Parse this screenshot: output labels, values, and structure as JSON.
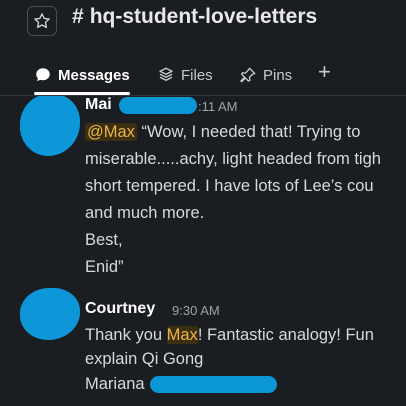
{
  "channel": {
    "hash": "#",
    "name": "hq-student-love-letters"
  },
  "tabs": [
    {
      "label": "Messages",
      "icon": "message-icon"
    },
    {
      "label": "Files",
      "icon": "files-icon"
    },
    {
      "label": "Pins",
      "icon": "pin-icon"
    }
  ],
  "add_tab": "+",
  "messages": [
    {
      "sender": "Mai",
      "time": ":11 AM",
      "lines": {
        "l1_mention": "@Max",
        "l1_rest": " “Wow, I needed that! Trying to",
        "l2": "miserable.....achy, light headed from tigh",
        "l3": "short tempered. I have lots of Lee’s cou",
        "l4": "and much more.",
        "l5": " Best,",
        "l6": "Enid”"
      }
    },
    {
      "sender": "Courtney",
      "time": "9:30 AM",
      "lines": {
        "l1_a": "Thank you ",
        "l1_hl": "Max",
        "l1_b": "! Fantastic analogy! Fun",
        "l2": "explain Qi Gong",
        "l3": "Mariana"
      }
    }
  ],
  "colors": {
    "background": "#1a1d21",
    "mention_bg": "#3b2f0f",
    "mention_fg": "#e8b54a",
    "redaction": "#0b96d6"
  }
}
